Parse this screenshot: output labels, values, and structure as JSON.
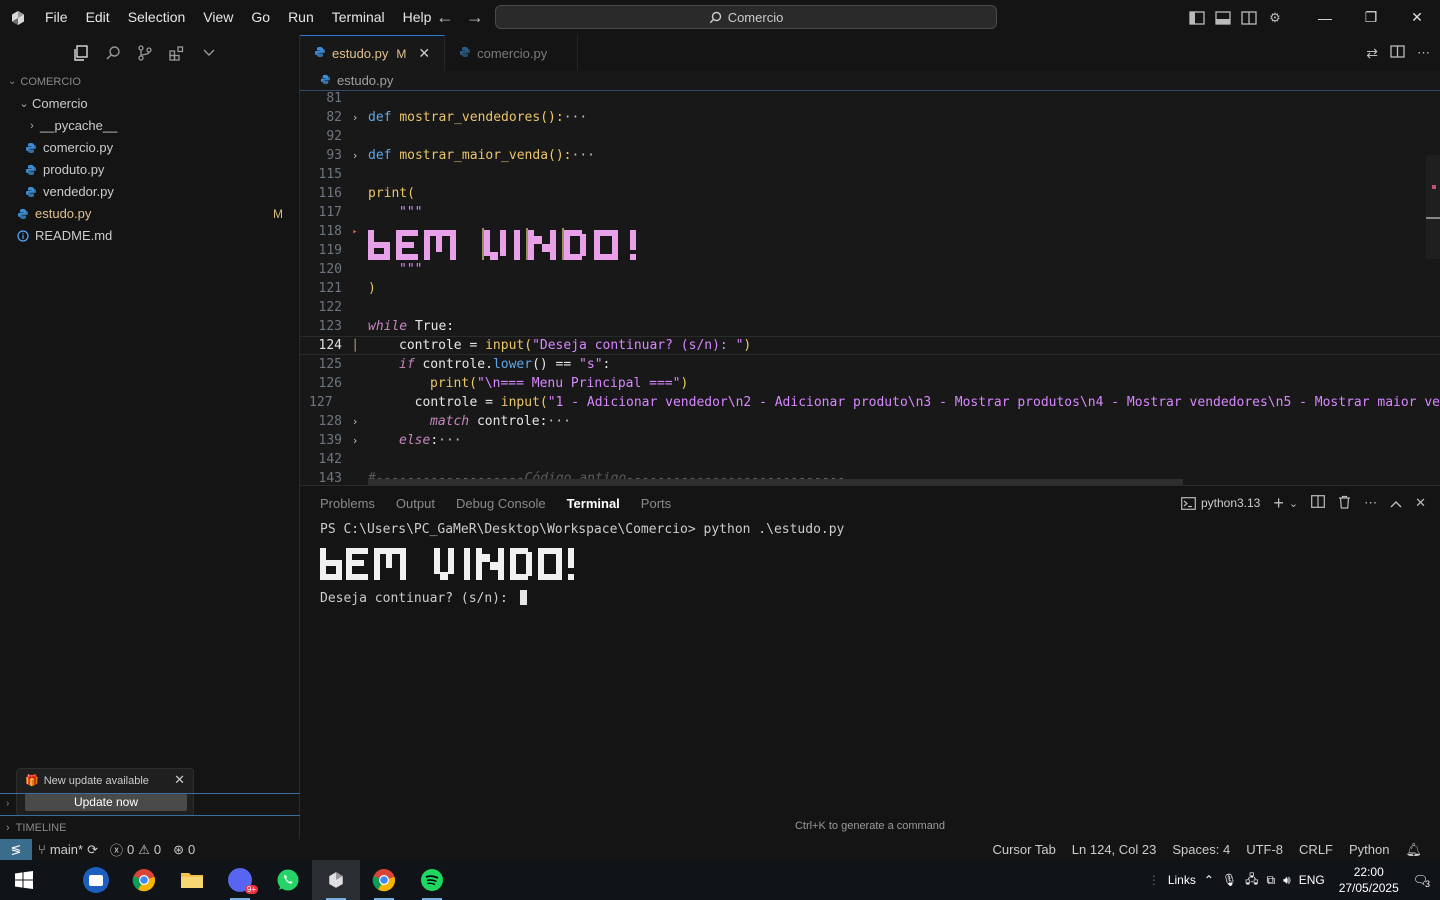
{
  "titlebar": {
    "menu": [
      "File",
      "Edit",
      "Selection",
      "View",
      "Go",
      "Run",
      "Terminal",
      "Help"
    ],
    "search_text": "Comercio"
  },
  "sidebar": {
    "section_title": "COMERCIO",
    "tree": [
      {
        "label": "Comercio",
        "kind": "folder-open",
        "indent": 1
      },
      {
        "label": "__pycache__",
        "kind": "folder",
        "indent": 2
      },
      {
        "label": "comercio.py",
        "kind": "python",
        "indent": 2
      },
      {
        "label": "produto.py",
        "kind": "python",
        "indent": 2
      },
      {
        "label": "vendedor.py",
        "kind": "python",
        "indent": 2
      },
      {
        "label": "estudo.py",
        "kind": "python",
        "indent": 1,
        "badge": "M"
      },
      {
        "label": "README.md",
        "kind": "info",
        "indent": 1
      }
    ],
    "notification": {
      "text": "New update available",
      "button": "Update now"
    },
    "timeline": "TIMELINE"
  },
  "editor": {
    "tabs": [
      {
        "label": "estudo.py",
        "modified": "M",
        "active": true
      },
      {
        "label": "comercio.py",
        "active": false
      }
    ],
    "breadcrumb": "estudo.py",
    "line_numbers": [
      "81",
      "82",
      "92",
      "93",
      "115",
      "116",
      "117",
      "118",
      "119",
      "120",
      "121",
      "122",
      "123",
      "124",
      "125",
      "126",
      "127",
      "128",
      "139",
      "142",
      "143"
    ],
    "code": {
      "l82_def": "def",
      "l82_name": "mostrar_vendedores",
      "l82_rest": "():",
      "l93_name": "mostrar_maior_venda",
      "l116": "print(",
      "l117": "\"\"\"",
      "l120": "\"\"\"",
      "l121": ")",
      "l123_kw": "while",
      "l123_rest": " True:",
      "l124_var": "controle",
      "l124_eq": " = ",
      "l124_fn": "input",
      "l124_str": "\"Deseja continuar? (s/n): \"",
      "l125_kw": "if",
      "l125_var": " controle.",
      "l125_fn": "lower",
      "l125_rest": "() == ",
      "l125_str": "\"s\"",
      "l125_colon": ":",
      "l126_fn": "print",
      "l126_str": "\"\\n=== Menu Principal ===\"",
      "l127_var": "controle",
      "l127_fn": "input",
      "l127_str": "\"1 - Adicionar vendedor\\n2 - Adicionar produto\\n3 - Mostrar produtos\\n4 - Mostrar vendedores\\n5 - Mostrar maior ve",
      "l128_kw": "match",
      "l128_rest": " controle:",
      "l139_kw": "else",
      "l139_rest": ":",
      "l143": "#-------------------Código antigo----------------------------",
      "ellipsis": "···"
    },
    "ascii_art_text": "BEM VINDO!"
  },
  "panel": {
    "tabs": [
      "Problems",
      "Output",
      "Debug Console",
      "Terminal",
      "Ports"
    ],
    "active_tab": "Terminal",
    "shell": "python3.13",
    "terminal": {
      "prompt_line": "PS C:\\Users\\PC_GaMeR\\Desktop\\Workspace\\Comercio> python .\\estudo.py",
      "input_line": "Deseja continuar? (s/n): "
    },
    "hint": "Ctrl+K to generate a command"
  },
  "statusbar": {
    "branch": "main*",
    "errors": "0",
    "warnings": "0",
    "ports": "0",
    "cursor_tab": "Cursor Tab",
    "position": "Ln 124, Col 23",
    "spaces": "Spaces: 4",
    "encoding": "UTF-8",
    "eol": "CRLF",
    "language": "Python"
  },
  "taskbar": {
    "tray_links": "Links",
    "lang": "ENG",
    "time": "22:00",
    "date": "27/05/2025",
    "notifications": "3"
  },
  "colors": {
    "accent": "#2b7bd6",
    "modified": "#e2c08d",
    "python_icon": "#3c8fd6",
    "art_pink": "#e8a0e8"
  }
}
